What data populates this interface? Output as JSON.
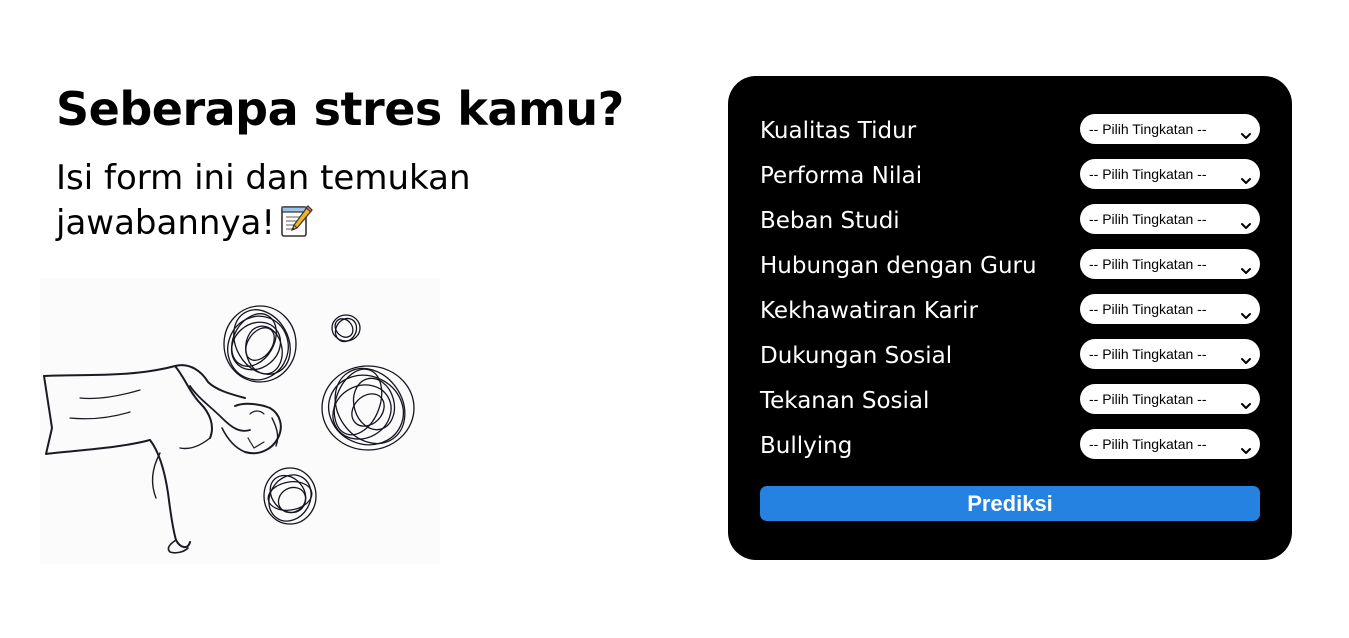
{
  "hero": {
    "title": "Seberapa stres kamu?",
    "subtitle": "Isi form ini dan temukan jawabannya!",
    "subtitle_icon": "memo-icon"
  },
  "illustration": {
    "icon": "stressed-person-illustration"
  },
  "form": {
    "fields": [
      {
        "label": "Kualitas Tidur",
        "selected": "-- Pilih Tingkatan --"
      },
      {
        "label": "Performa Nilai",
        "selected": "-- Pilih Tingkatan --"
      },
      {
        "label": "Beban Studi",
        "selected": "-- Pilih Tingkatan --"
      },
      {
        "label": "Hubungan dengan Guru",
        "selected": "-- Pilih Tingkatan --"
      },
      {
        "label": "Kekhawatiran Karir",
        "selected": "-- Pilih Tingkatan --"
      },
      {
        "label": "Dukungan Sosial",
        "selected": "-- Pilih Tingkatan --"
      },
      {
        "label": "Tekanan Sosial",
        "selected": "-- Pilih Tingkatan --"
      },
      {
        "label": "Bullying",
        "selected": "-- Pilih Tingkatan --"
      }
    ],
    "submit_label": "Prediksi"
  },
  "colors": {
    "card_background": "#000000",
    "button": "#2582e1",
    "text_on_dark": "#ffffff"
  }
}
